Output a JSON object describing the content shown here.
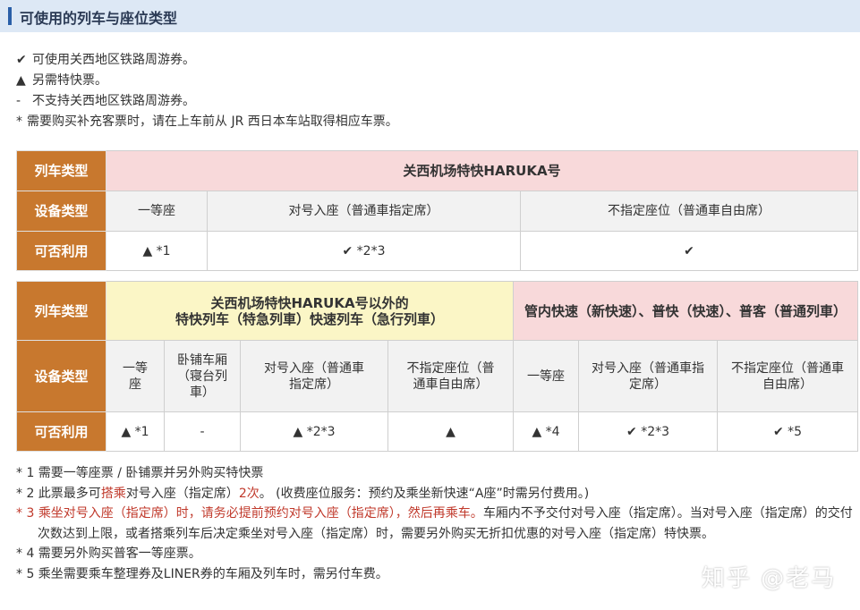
{
  "header": {
    "title": "可使用的列车与座位类型"
  },
  "legend": [
    {
      "symbol": "✔",
      "text": "可使用关西地区铁路周游券。"
    },
    {
      "symbol": "▲",
      "text": "另需特快票。"
    },
    {
      "symbol": "-",
      "text": "不支持关西地区铁路周游券。"
    },
    {
      "symbol": "*",
      "text": "需要购买补充客票时，请在上车前从 JR 西日本车站取得相应车票。"
    }
  ],
  "table1": {
    "row_labels": [
      "列车类型",
      "设备类型",
      "可否利用"
    ],
    "train": "关西机场特快HARUKA号",
    "seats": [
      "一等座",
      "对号入座（普通車指定席）",
      "不指定座位（普通車自由席）"
    ],
    "availability": [
      "▲ *1",
      "✔ *2*3",
      "✔"
    ]
  },
  "table2": {
    "row_labels": [
      "列车类型",
      "设备类型",
      "可否利用"
    ],
    "train_a_line1": "关西机场特快HARUKA号以外的",
    "train_a_line2": "特快列车（特急列車）快速列车（急行列車）",
    "train_b": "管内快速（新快速）、普快（快速）、普客（普通列車）",
    "seats": [
      "一等座",
      "卧铺车厢（寝台列車）",
      "对号入座（普通車指定席）",
      "不指定座位（普通車自由席）",
      "一等座",
      "对号入座（普通車指定席）",
      "不指定座位（普通車自由席）"
    ],
    "availability": [
      "▲ *1",
      "-",
      "▲ *2*3",
      "▲",
      "▲ *4",
      "✔ *2*3",
      "✔ *5"
    ]
  },
  "notes": {
    "n1": "* 1 需要一等座票 / 卧铺票并另外购买特快票",
    "n2_a": "* 2 此票最多可",
    "n2_red1": "搭乘",
    "n2_b": "对号入座（指定席）",
    "n2_red2": "2次",
    "n2_c": "。 (收费座位服务：预约及乘坐新快速“A座”时需另付费用。)",
    "n3_prefix": "* 3 ",
    "n3_red": "乘坐对号入座（指定席）时，请务必提前预约对号入座（指定席），然后再乘车。",
    "n3_rest": "车厢内不予交付对号入座（指定席）。当对号入座（指定席）的交付次数达到上限，或者搭乘列车后决定乘坐对号入座（指定席）时，需要另外购买无折扣优惠的对号入座（指定席）特快票。",
    "n4": "* 4 需要另外购买普客一等座票。",
    "n5": "* 5 乘坐需要乘车整理券及LINER券的车厢及列车时，需另付车费。"
  },
  "watermark": "知乎 @老马"
}
